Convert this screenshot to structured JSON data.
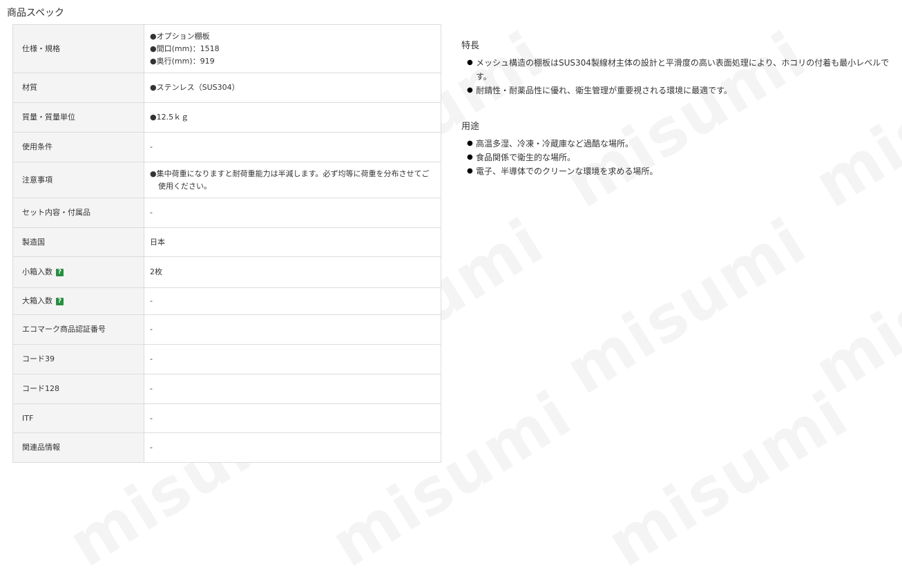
{
  "watermark_text": "misumi",
  "section_title": "商品スペック",
  "spec_rows": [
    {
      "label": "仕様・規格",
      "values": [
        "●オプション棚板",
        "●間口(mm)：1518",
        "●奥行(mm)：919"
      ]
    },
    {
      "label": "材質",
      "values": [
        "●ステンレス（SUS304）"
      ]
    },
    {
      "label": "質量・質量単位",
      "values": [
        "●12.5ｋｇ"
      ]
    },
    {
      "label": "使用条件",
      "values": [
        "-"
      ]
    },
    {
      "label": "注意事項",
      "values": [
        "●集中荷重になりますと耐荷重能力は半減します。必ず均等に荷重を分布させてご使用ください。"
      ]
    },
    {
      "label": "セット内容・付属品",
      "values": [
        "-"
      ]
    },
    {
      "label": "製造国",
      "values": [
        "日本"
      ]
    },
    {
      "label": "小箱入数",
      "help": "?",
      "values": [
        "2枚"
      ]
    },
    {
      "label": "大箱入数",
      "help": "?",
      "values": [
        "-"
      ]
    },
    {
      "label": "エコマーク商品認証番号",
      "values": [
        "-"
      ]
    },
    {
      "label": "コード39",
      "values": [
        "-"
      ]
    },
    {
      "label": "コード128",
      "values": [
        "-"
      ]
    },
    {
      "label": "ITF",
      "values": [
        "-"
      ]
    },
    {
      "label": "関連品情報",
      "values": [
        "-"
      ]
    }
  ],
  "features": {
    "title": "特長",
    "items": [
      "メッシュ構造の棚板はSUS304製線材主体の設計と平滑度の高い表面処理により、ホコリの付着も最小レベルです。",
      "耐錆性・耐薬品性に優れ、衛生管理が重要視される環境に最適です。"
    ]
  },
  "uses": {
    "title": "用途",
    "items": [
      "高温多湿、冷凍・冷蔵庫など過酷な場所。",
      "食品関係で衛生的な場所。",
      "電子、半導体でのクリーンな環境を求める場所。"
    ]
  },
  "colors": {
    "help_icon": "#2c8c45",
    "label_bg": "#f4f4f4",
    "border": "#dcdcdc"
  }
}
